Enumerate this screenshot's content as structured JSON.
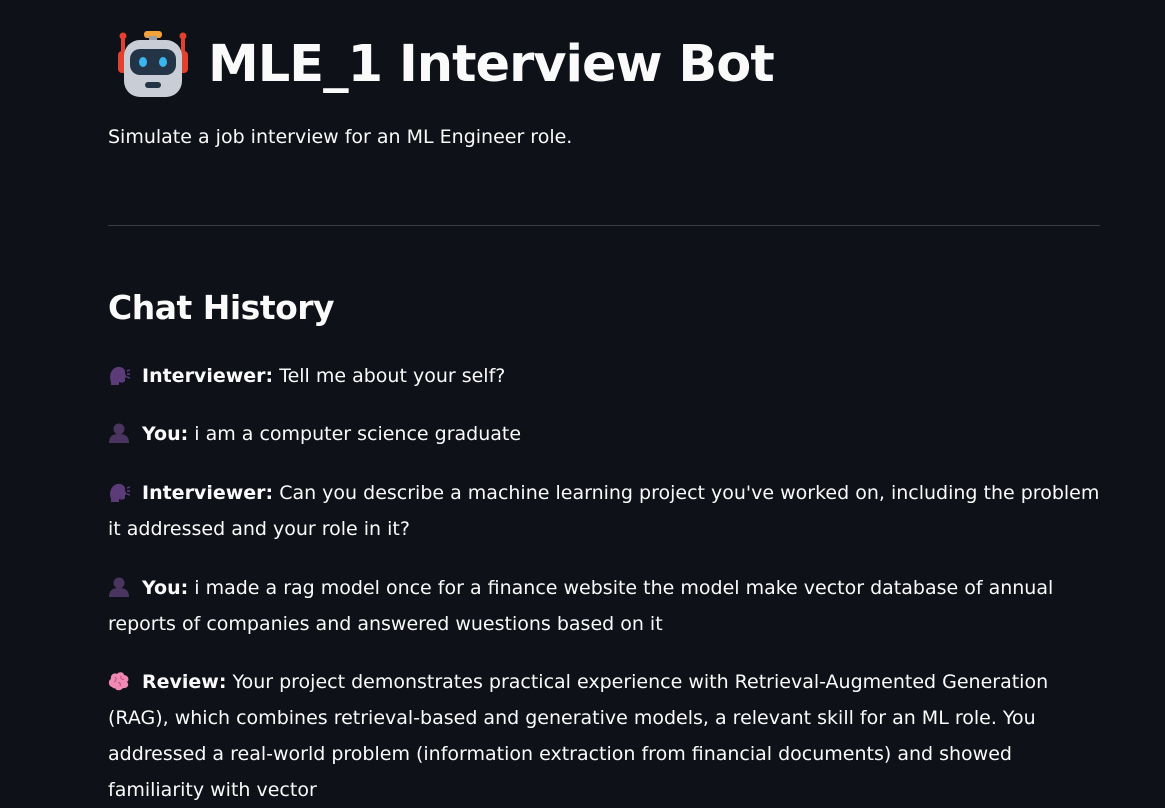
{
  "header": {
    "icon": "robot-icon",
    "title": "MLE_1 Interview Bot",
    "subtitle": "Simulate a job interview for an ML Engineer role."
  },
  "chat": {
    "heading": "Chat History",
    "messages": [
      {
        "icon": "speaking-head-icon",
        "role": "Interviewer:",
        "text": "Tell me about your self?"
      },
      {
        "icon": "user-silhouette-icon",
        "role": "You:",
        "text": "i am a computer science graduate"
      },
      {
        "icon": "speaking-head-icon",
        "role": "Interviewer:",
        "text": "Can you describe a machine learning project you've worked on, including the problem it addressed and your role in it?"
      },
      {
        "icon": "user-silhouette-icon",
        "role": "You:",
        "text": "i made a rag model once for a finance website the model make vector database of annual reports of companies and answered wuestions based on it"
      },
      {
        "icon": "brain-icon",
        "role": "Review:",
        "text": "Your project demonstrates practical experience with Retrieval-Augmented Generation (RAG), which combines retrieval-based and generative models, a relevant skill for an ML role. You addressed a real-world problem (information extraction from financial documents) and showed familiarity with vector"
      }
    ]
  },
  "colors": {
    "background": "#0e1117",
    "text": "#fafafa",
    "divider": "#3a3d45"
  }
}
